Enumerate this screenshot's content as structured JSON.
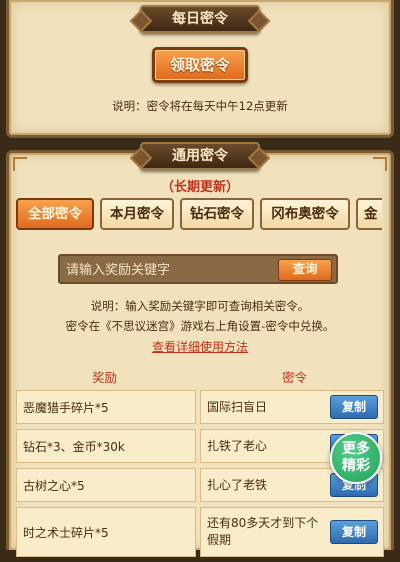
{
  "daily": {
    "title": "每日密令",
    "claim_button": "领取密令",
    "note": "说明：密令将在每天中午12点更新"
  },
  "general": {
    "title": "通用密令",
    "subtitle": "（长期更新）",
    "tabs": [
      {
        "label": "全部密令",
        "active": true
      },
      {
        "label": "本月密令",
        "active": false
      },
      {
        "label": "钻石密令",
        "active": false
      },
      {
        "label": "冈布奥密令",
        "active": false
      },
      {
        "label": "金",
        "active": false
      }
    ],
    "search": {
      "placeholder": "请输入奖励关键字",
      "button": "查询"
    },
    "note_line1": "说明：输入奖励关键字即可查询相关密令。",
    "note_line2": "密令在《不思议迷宫》游戏右上角设置-密令中兑换。",
    "detail_link": "查看详细使用方法",
    "columns": {
      "reward": "奖励",
      "code": "密令"
    },
    "rows": [
      {
        "reward": "恶魔猎手碎片*5",
        "code": "国际扫盲日",
        "copy": "复制"
      },
      {
        "reward": "钻石*3、金币*30k",
        "code": "扎铁了老心",
        "copy": "复制"
      },
      {
        "reward": "古树之心*5",
        "code": "扎心了老铁",
        "copy": "复制"
      },
      {
        "reward": "时之术士碎片*5",
        "code": "还有80多天才到下个假期",
        "copy": "复制"
      }
    ]
  },
  "float_button": {
    "line1": "更多",
    "line2": "精彩"
  },
  "colors": {
    "accent_orange": "#e06a1e",
    "title_red": "#c0321a",
    "copy_blue": "#2e6ab0",
    "float_green": "#23a05c",
    "parchment": "#f1e2bd"
  }
}
